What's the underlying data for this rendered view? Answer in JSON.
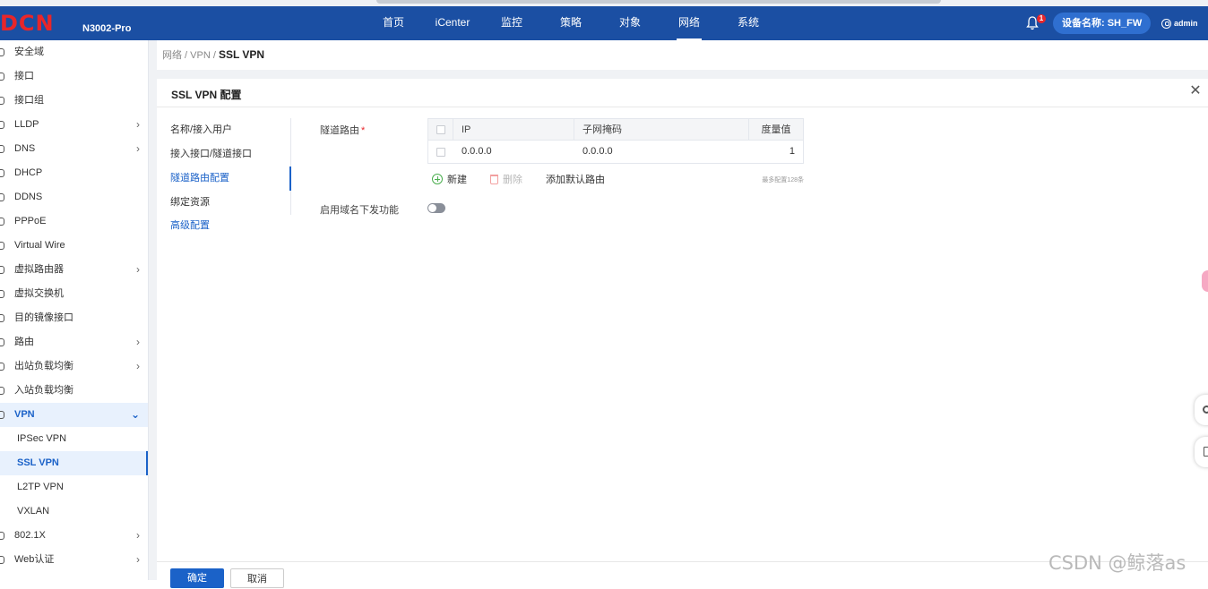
{
  "header": {
    "logo_text": "DCN",
    "model": "N3002-Pro",
    "nav": [
      "首页",
      "iCenter",
      "监控",
      "策略",
      "对象",
      "网络",
      "系统"
    ],
    "active_nav": "网络",
    "notification_count": "1",
    "device_label": "设备名称: SH_FW",
    "user": "admin"
  },
  "sidebar": {
    "items": [
      {
        "label": "安全域",
        "has_children": false
      },
      {
        "label": "接口",
        "has_children": false
      },
      {
        "label": "接口组",
        "has_children": false
      },
      {
        "label": "LLDP",
        "has_children": true
      },
      {
        "label": "DNS",
        "has_children": true
      },
      {
        "label": "DHCP",
        "has_children": false
      },
      {
        "label": "DDNS",
        "has_children": false
      },
      {
        "label": "PPPoE",
        "has_children": false
      },
      {
        "label": "Virtual Wire",
        "has_children": false
      },
      {
        "label": "虚拟路由器",
        "has_children": true
      },
      {
        "label": "虚拟交换机",
        "has_children": false
      },
      {
        "label": "目的镜像接口",
        "has_children": false
      },
      {
        "label": "路由",
        "has_children": true
      },
      {
        "label": "出站负载均衡",
        "has_children": true
      },
      {
        "label": "入站负载均衡",
        "has_children": false
      }
    ],
    "vpn": {
      "label": "VPN",
      "children": [
        "IPSec VPN",
        "SSL VPN",
        "L2TP VPN",
        "VXLAN"
      ],
      "active_child": "SSL VPN"
    },
    "items_after": [
      {
        "label": "802.1X",
        "has_children": true
      },
      {
        "label": "Web认证",
        "has_children": true
      }
    ]
  },
  "breadcrumb": {
    "parent": "网络 / VPN / ",
    "current": "SSL VPN"
  },
  "panel": {
    "title": "SSL VPN 配置",
    "steps": [
      "名称/接入用户",
      "接入接口/隧道接口",
      "隧道路由配置",
      "绑定资源"
    ],
    "active_step": "隧道路由配置",
    "advanced_link": "高级配置",
    "tunnel_route_label": "隧道路由",
    "required_mark": "*",
    "table": {
      "headers": [
        "IP",
        "子网掩码",
        "度量值"
      ],
      "rows": [
        {
          "ip": "0.0.0.0",
          "mask": "0.0.0.0",
          "metric": "1"
        }
      ]
    },
    "actions": {
      "add": "新建",
      "delete": "删除",
      "add_default_route": "添加默认路由",
      "max_note": "最多配置128条"
    },
    "domain_push_label": "启用域名下发功能",
    "domain_push_enabled": false,
    "confirm": "确定",
    "cancel": "取消"
  },
  "watermark": "CSDN @鲸落as"
}
